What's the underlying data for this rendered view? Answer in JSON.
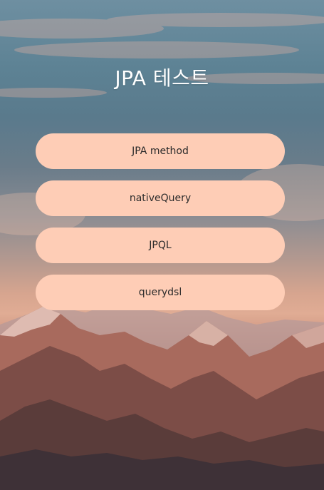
{
  "app": {
    "title": "JPA 테스트"
  },
  "buttons": [
    {
      "label": "JPA method"
    },
    {
      "label": "nativeQuery"
    },
    {
      "label": "JPQL"
    },
    {
      "label": "querydsl"
    }
  ],
  "theme": {
    "button_bg": "#fecdb6",
    "button_text": "#2b2b2b",
    "title_color": "#ffffff"
  },
  "background": {
    "scene": "mountain-sunset-image"
  }
}
